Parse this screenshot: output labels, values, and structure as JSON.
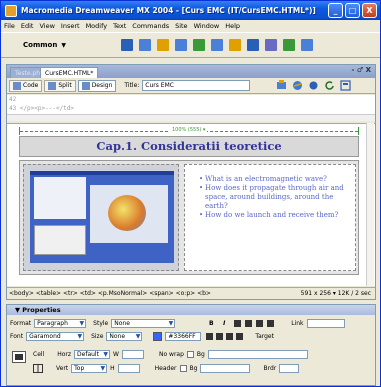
{
  "window": {
    "title": "Macromedia Dreamweaver MX 2004 - [Curs EMC (IT/CursEMC.HTML*)]",
    "controls": [
      "_",
      "□",
      "X"
    ]
  },
  "menu": [
    "File",
    "Edit",
    "View",
    "Insert",
    "Modify",
    "Text",
    "Commands",
    "Site",
    "Window",
    "Help"
  ],
  "insert_bar": {
    "category": "Common",
    "icon_colors": [
      "#2a5fb8",
      "#4a80d8",
      "#e0a000",
      "#4a80d8",
      "#3a9a3a",
      "#4a80d8",
      "#e0a000",
      "#2a5fb8",
      "#6a6ac0",
      "#3a9a3a",
      "#4a80d8"
    ]
  },
  "document": {
    "tabs": [
      "Teste.php",
      "CursEMC.HTML*"
    ],
    "window_controls": "- ♂ X",
    "toolbar": {
      "code": "Code",
      "split": "Split",
      "design": "Design",
      "title_label": "Title:",
      "title_value": "Curs EMC"
    },
    "code_lines": [
      "42",
      "43  </p><p>---</td>"
    ],
    "rule_label": "100% (555) ▾",
    "heading": "Cap.1. Consideratii teoretice",
    "bullets": [
      "What is an electromagnetic wave?",
      "How does it propagate through air and space, around buildings, around the earth?",
      "How do we launch and receive them?"
    ],
    "tag_selector": "<body> <table> <tr> <td> <p.MsoNormal> <span> <o:p> <b>",
    "window_size": "591 x 256 ▾ 12K / 2 sec"
  },
  "properties": {
    "title": "▼ Properties",
    "format_label": "Format",
    "format_value": "Paragraph",
    "style_label": "Style",
    "style_value": "None",
    "bold": "B",
    "italic": "I",
    "link_label": "Link",
    "font_label": "Font",
    "font_value": "Garamond",
    "size_label": "Size",
    "size_value": "None",
    "color_value": "#3366FF",
    "target_label": "Target",
    "cell_label": "Cell",
    "horz_label": "Horz",
    "horz_value": "Default",
    "w_label": "W",
    "nowrap_label": "No wrap",
    "bg_label": "Bg",
    "vert_label": "Vert",
    "vert_value": "Top",
    "h_label": "H",
    "header_label": "Header",
    "brdr_label": "Brdr"
  }
}
